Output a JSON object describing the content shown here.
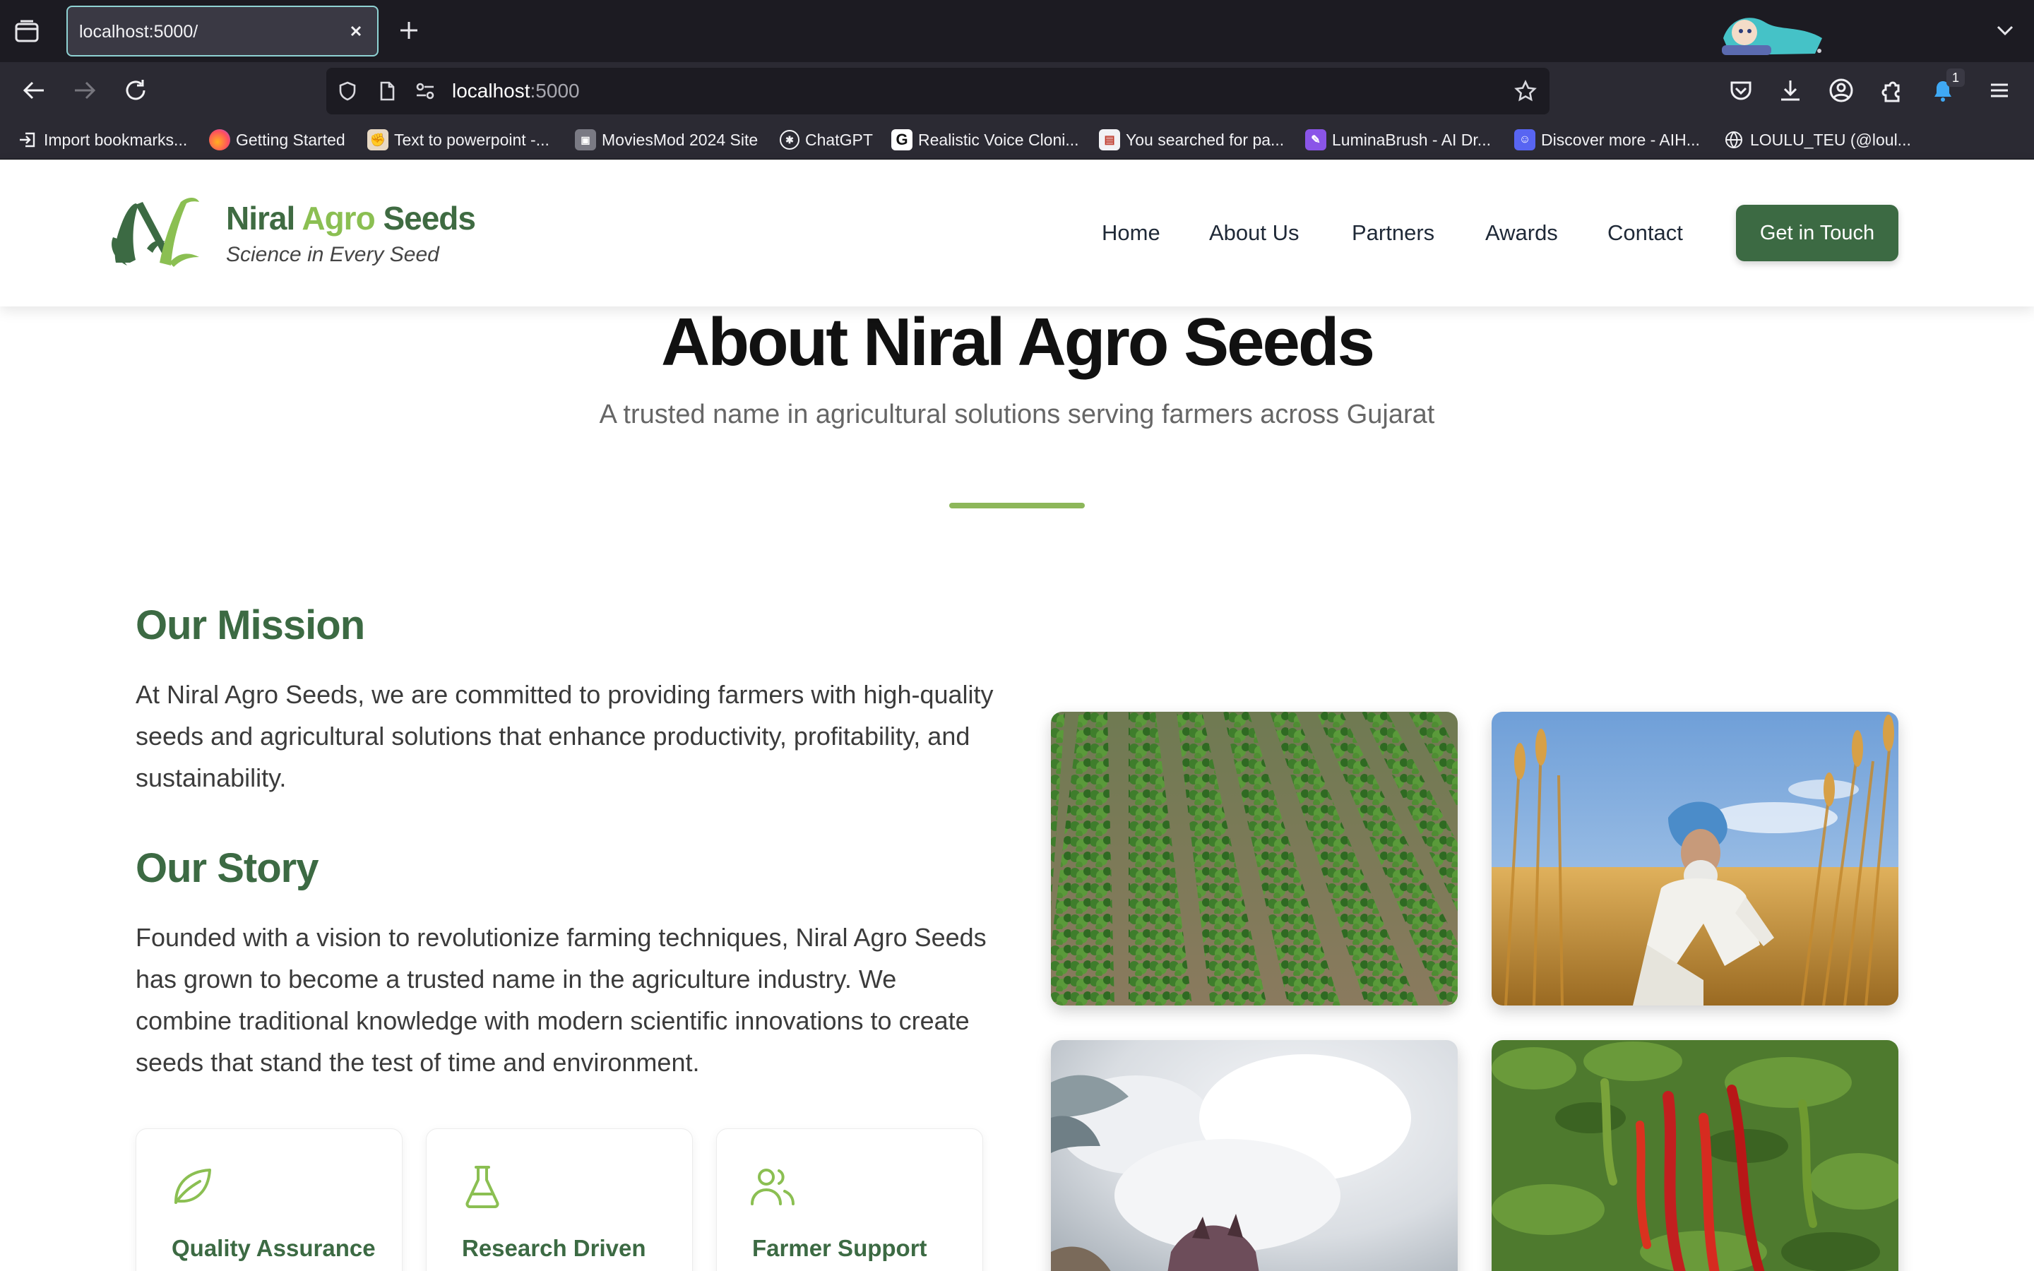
{
  "browser": {
    "tab_title": "localhost:5000/",
    "url_host": "localhost",
    "url_port": ":5000",
    "notification_count": "1",
    "bookmarks": [
      {
        "label": "Import bookmarks...",
        "icon": "import-icon"
      },
      {
        "label": "Getting Started",
        "icon": "firefox-icon"
      },
      {
        "label": "Text to powerpoint -...",
        "icon": "muscle-icon"
      },
      {
        "label": "MoviesMod 2024 Site",
        "icon": "film-icon"
      },
      {
        "label": "ChatGPT",
        "icon": "chatgpt-icon"
      },
      {
        "label": "Realistic Voice Cloni...",
        "icon": "g-icon"
      },
      {
        "label": "You searched for pa...",
        "icon": "page-icon"
      },
      {
        "label": "LuminaBrush - AI Dr...",
        "icon": "brush-icon"
      },
      {
        "label": "Discover more - AIH...",
        "icon": "discord-icon"
      },
      {
        "label": "LOULU_TEU (@loul...",
        "icon": "globe-icon"
      }
    ]
  },
  "site": {
    "brand_main": "Niral ",
    "brand_accent": "Agro",
    "brand_end": " Seeds",
    "tagline": "Science in Every Seed",
    "nav": [
      "Home",
      "About Us",
      "Partners",
      "Awards",
      "Contact"
    ],
    "cta": "Get in Touch"
  },
  "about": {
    "title": "About Niral Agro Seeds",
    "subtitle": "A trusted name in agricultural solutions serving farmers across Gujarat",
    "mission_heading": "Our Mission",
    "mission_text": "At Niral Agro Seeds, we are committed to providing farmers with high-quality seeds and agricultural solutions that enhance productivity, profitability, and sustainability.",
    "story_heading": "Our Story",
    "story_text": "Founded with a vision to revolutionize farming techniques, Niral Agro Seeds has grown to become a trusted name in the agriculture industry. We combine traditional knowledge with modern scientific innovations to create seeds that stand the test of time and environment.",
    "features": [
      {
        "title": "Quality Assurance",
        "icon": "leaf-icon"
      },
      {
        "title": "Research Driven",
        "icon": "flask-icon"
      },
      {
        "title": "Farmer Support",
        "icon": "users-icon"
      }
    ],
    "photos": [
      "crop-rows-photo",
      "farmer-wheat-photo",
      "cotton-photo",
      "chili-photo"
    ]
  },
  "colors": {
    "brand_green": "#3c6a43",
    "accent_green": "#8bbf52",
    "browser_dark": "#1c1b22",
    "browser_bar": "#2b2a33"
  }
}
